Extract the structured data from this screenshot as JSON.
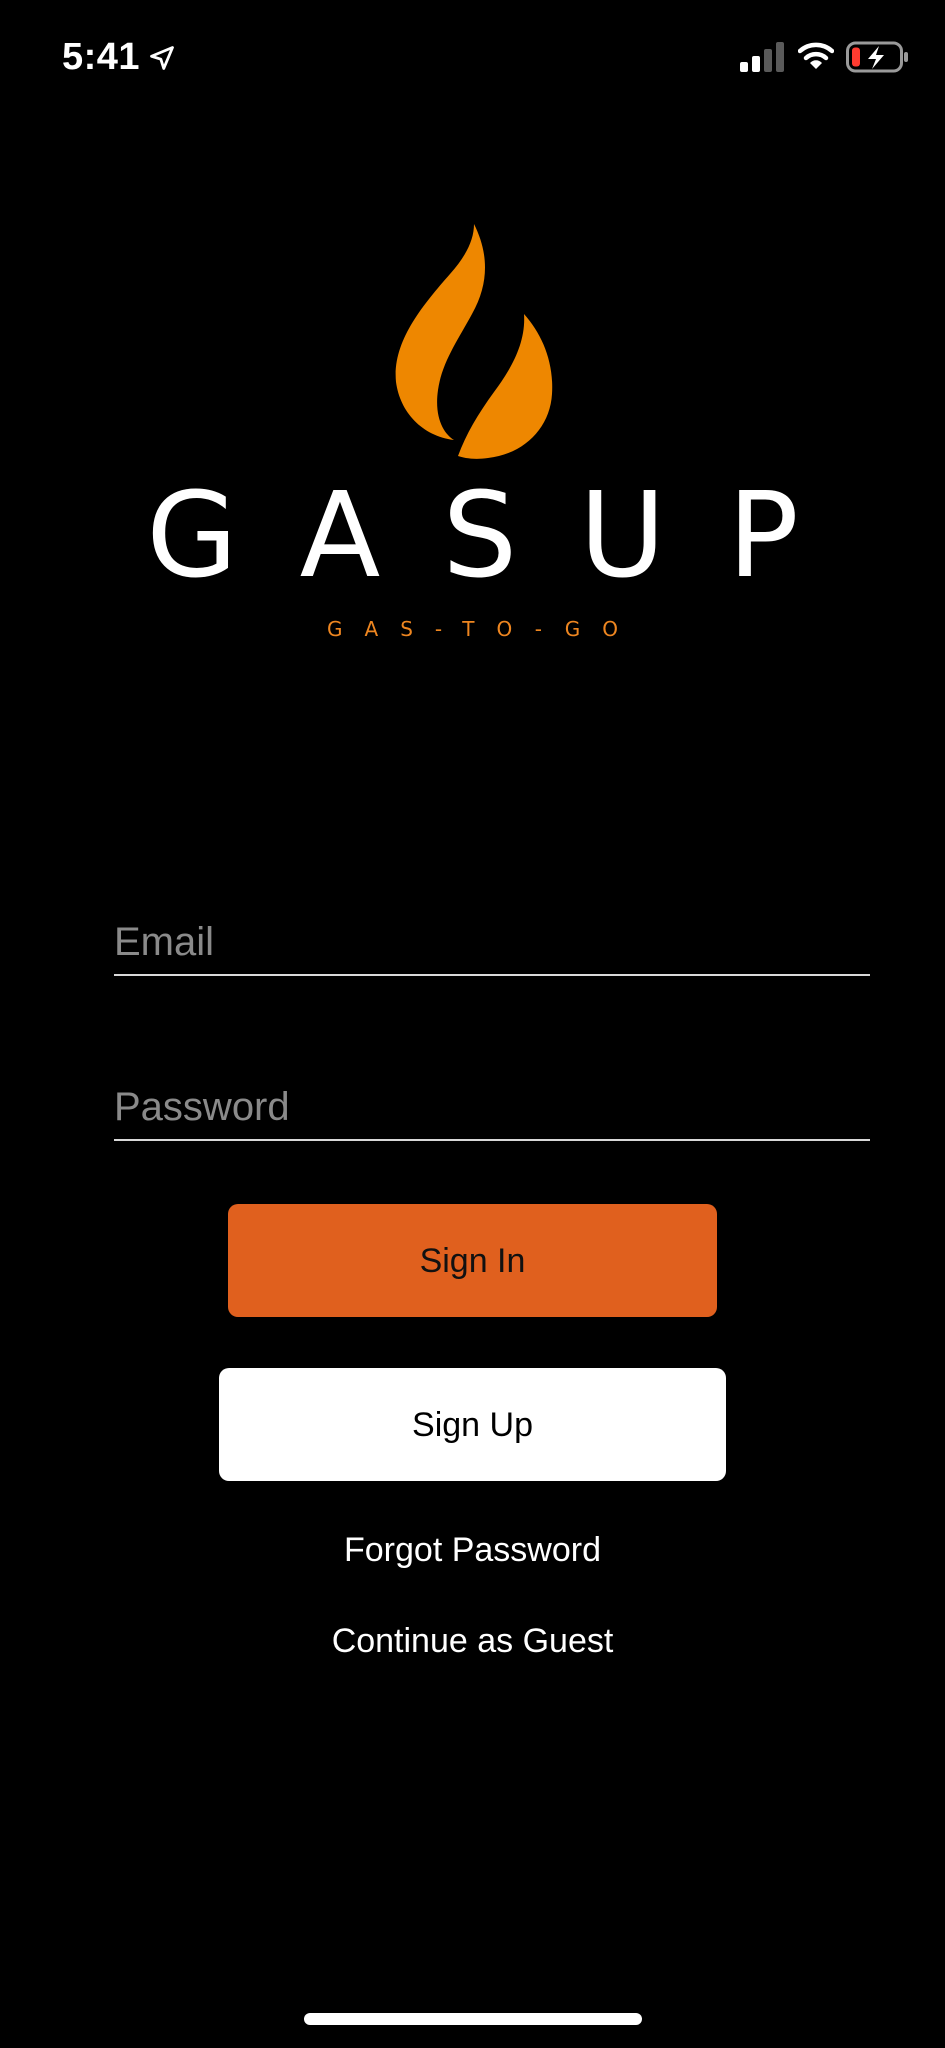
{
  "status_bar": {
    "time": "5:41",
    "icons": [
      "location-arrow-icon",
      "cellular-signal-icon",
      "wifi-icon",
      "battery-charging-icon"
    ]
  },
  "logo": {
    "icon": "flame-icon",
    "wordmark": "GASUP",
    "tagline": "GAS-TO-GO",
    "colors": {
      "flame": "#ee8700",
      "tagline": "#ee8620"
    }
  },
  "form": {
    "email_placeholder": "Email",
    "email_value": "",
    "password_placeholder": "Password",
    "password_value": ""
  },
  "actions": {
    "sign_in_label": "Sign In",
    "sign_up_label": "Sign Up",
    "forgot_password_label": "Forgot Password",
    "guest_label": "Continue as Guest"
  },
  "colors": {
    "background": "#000000",
    "accent": "#e0601e",
    "secondary_button": "#ffffff"
  }
}
